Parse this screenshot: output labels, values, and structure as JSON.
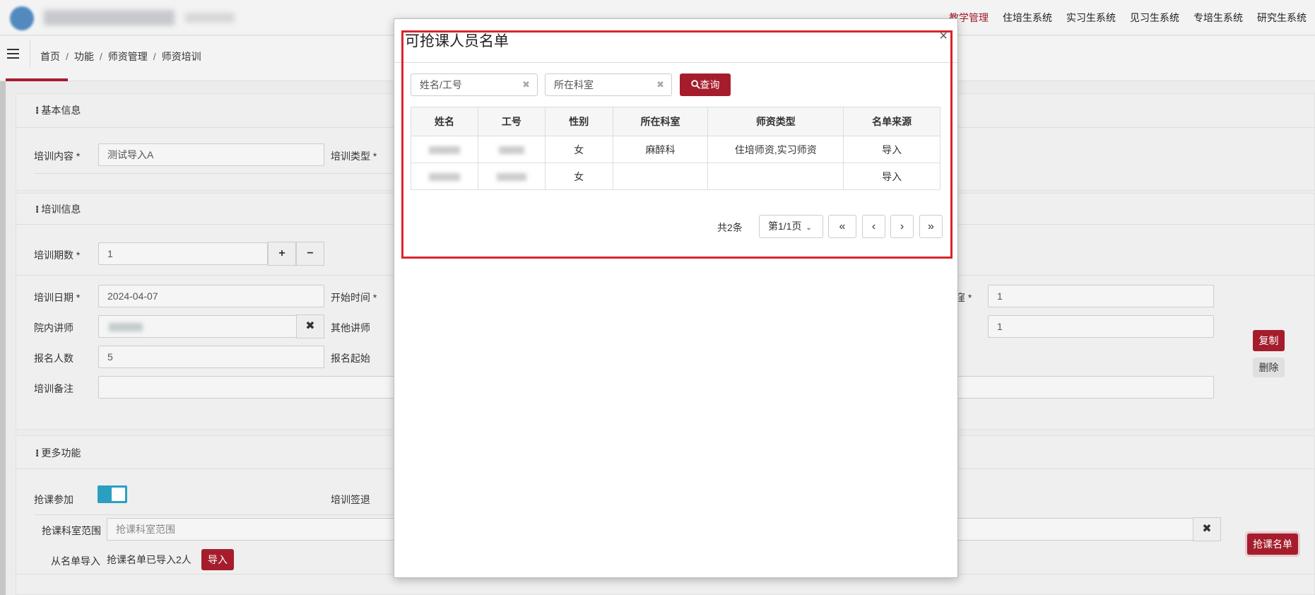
{
  "topnav": {
    "items": [
      "教学管理",
      "住培生系统",
      "实习生系统",
      "见习生系统",
      "专培生系统",
      "研究生系统"
    ],
    "active_color": "#9d1b2a"
  },
  "breadcrumb": [
    "首页",
    "功能",
    "师资管理",
    "师资培训"
  ],
  "basic": {
    "title": "基本信息",
    "content_label": "培训内容 *",
    "content_value": "测试导入A",
    "type_label": "培训类型 *"
  },
  "training": {
    "title": "培训信息",
    "periods_label": "培训期数 *",
    "periods_value": "1",
    "date_label": "培训日期 *",
    "date_value": "2024-04-07",
    "start_label": "开始时间 *",
    "right_label1": "窪 *",
    "right_value1": "1",
    "right_value2": "1",
    "inner_lecturer_label": "院内讲师",
    "other_lecturer_label": "其他讲师",
    "signup_count_label": "报名人数",
    "signup_count_value": "5",
    "signup_start_label": "报名起始",
    "remark_label": "培训备注",
    "copy_label": "复制",
    "delete_label": "删除"
  },
  "more": {
    "title": "更多功能",
    "grab_join_label": "抢课参加",
    "grab_join_on": true,
    "signout_label": "培训签退",
    "dept_range_label": "抢课科室范围",
    "dept_range_placeholder": "抢课科室范围",
    "import_label": "从名单导入",
    "import_status": "抢课名单已导入2人",
    "import_button": "导入",
    "grab_list_button": "抢课名单"
  },
  "modal": {
    "title": "可抢课人员名单",
    "close": "×",
    "search_name_placeholder": "姓名/工号",
    "search_dept_placeholder": "所在科室",
    "query_button": "查询",
    "columns": [
      "姓名",
      "工号",
      "性别",
      "所在科室",
      "师资类型",
      "名单来源"
    ],
    "rows": [
      {
        "gender": "女",
        "dept": "麻醉科",
        "teacher_type": "住培师资,实习师资",
        "source": "导入"
      },
      {
        "gender": "女",
        "dept": "",
        "teacher_type": "",
        "source": "导入"
      }
    ],
    "total": "共2条",
    "page_select": "第1/1页",
    "first": "«",
    "prev": "‹",
    "next": "›",
    "last": "»"
  }
}
